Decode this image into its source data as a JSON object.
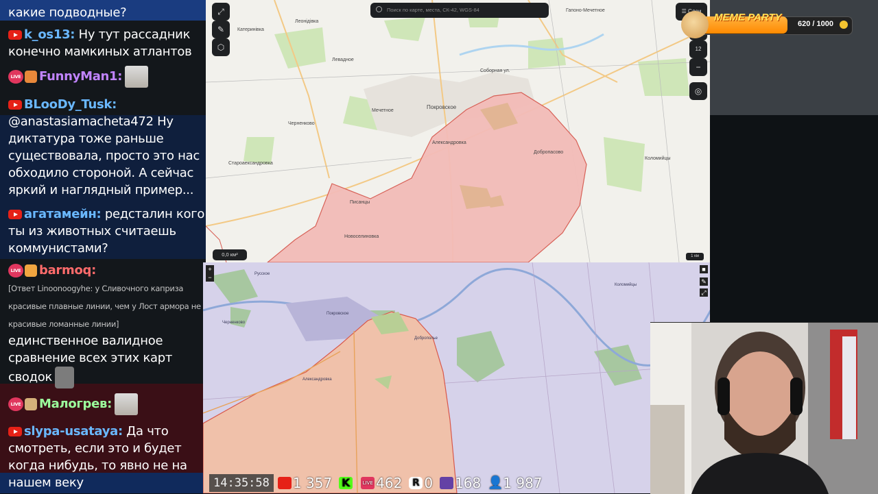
{
  "chat": {
    "messages": [
      {
        "platform": "",
        "name": "",
        "text": "какие подводные?"
      },
      {
        "platform": "youtube",
        "name": "k_os13:",
        "text": "Ну тут рассадник конечно мамкиных атлантов"
      },
      {
        "platform": "vklive",
        "name": "FunnyMan1:",
        "text": ""
      },
      {
        "platform": "youtube",
        "name": "BLooDy_Tusk:",
        "text": "@anastasiamacheta472 Ну диктатура тоже раньше существовала, просто это нас обходило стороной. А сейчас яркий и наглядный пример..."
      },
      {
        "platform": "youtube",
        "name": "агатамейн:",
        "text": "редсталин кого ты из животных считаешь коммунистами?"
      },
      {
        "platform": "vklive",
        "name": "barmoq:",
        "reply": "[Ответ Linoonoogyhe: у Сливочного каприза красивые плавные линии, чем у Лост армора не красивые ломанные линии]",
        "text": "единственное валидное сравнение всех этих карт сводок"
      },
      {
        "platform": "vklive",
        "name": "Малогрев:",
        "text": ""
      },
      {
        "platform": "youtube",
        "name": "slypa-usataya:",
        "text": "Да что смотреть, если это и будет когда нибудь, то явно не на нашем веку"
      }
    ]
  },
  "map1": {
    "search_placeholder": "Поиск по карте, места, СК-42, WGS-84",
    "layers_label": "Слои",
    "zoom_level": "12",
    "zoom_in": "+",
    "zoom_out": "−",
    "area_readout": "0,0 км²",
    "scale": "1 км",
    "places": [
      "Катеринівка",
      "Леонідівка",
      "Левадное",
      "Мечетное",
      "Покровское",
      "Черненково",
      "Александровка",
      "Добропасово",
      "Коломийцы",
      "Староаександровка",
      "Писанцы",
      "Новоселиновка",
      "Гапоно-Мечетное",
      "Соборная ул."
    ]
  },
  "map2": {
    "zoom_in": "+",
    "zoom_out": "−",
    "places": [
      "Русское",
      "Покровское",
      "Александровка",
      "Доброполье",
      "Коломийцы",
      "Черненково"
    ]
  },
  "overlay": {
    "title": "MEME PARTY",
    "progress_text": "620 / 1000",
    "progress_value": 0.62
  },
  "stats": {
    "time": "14:35:58",
    "youtube": "1 357",
    "kick": "",
    "vklive": "462",
    "rutube": "0",
    "twitch": "168",
    "viewers": "1 987"
  }
}
